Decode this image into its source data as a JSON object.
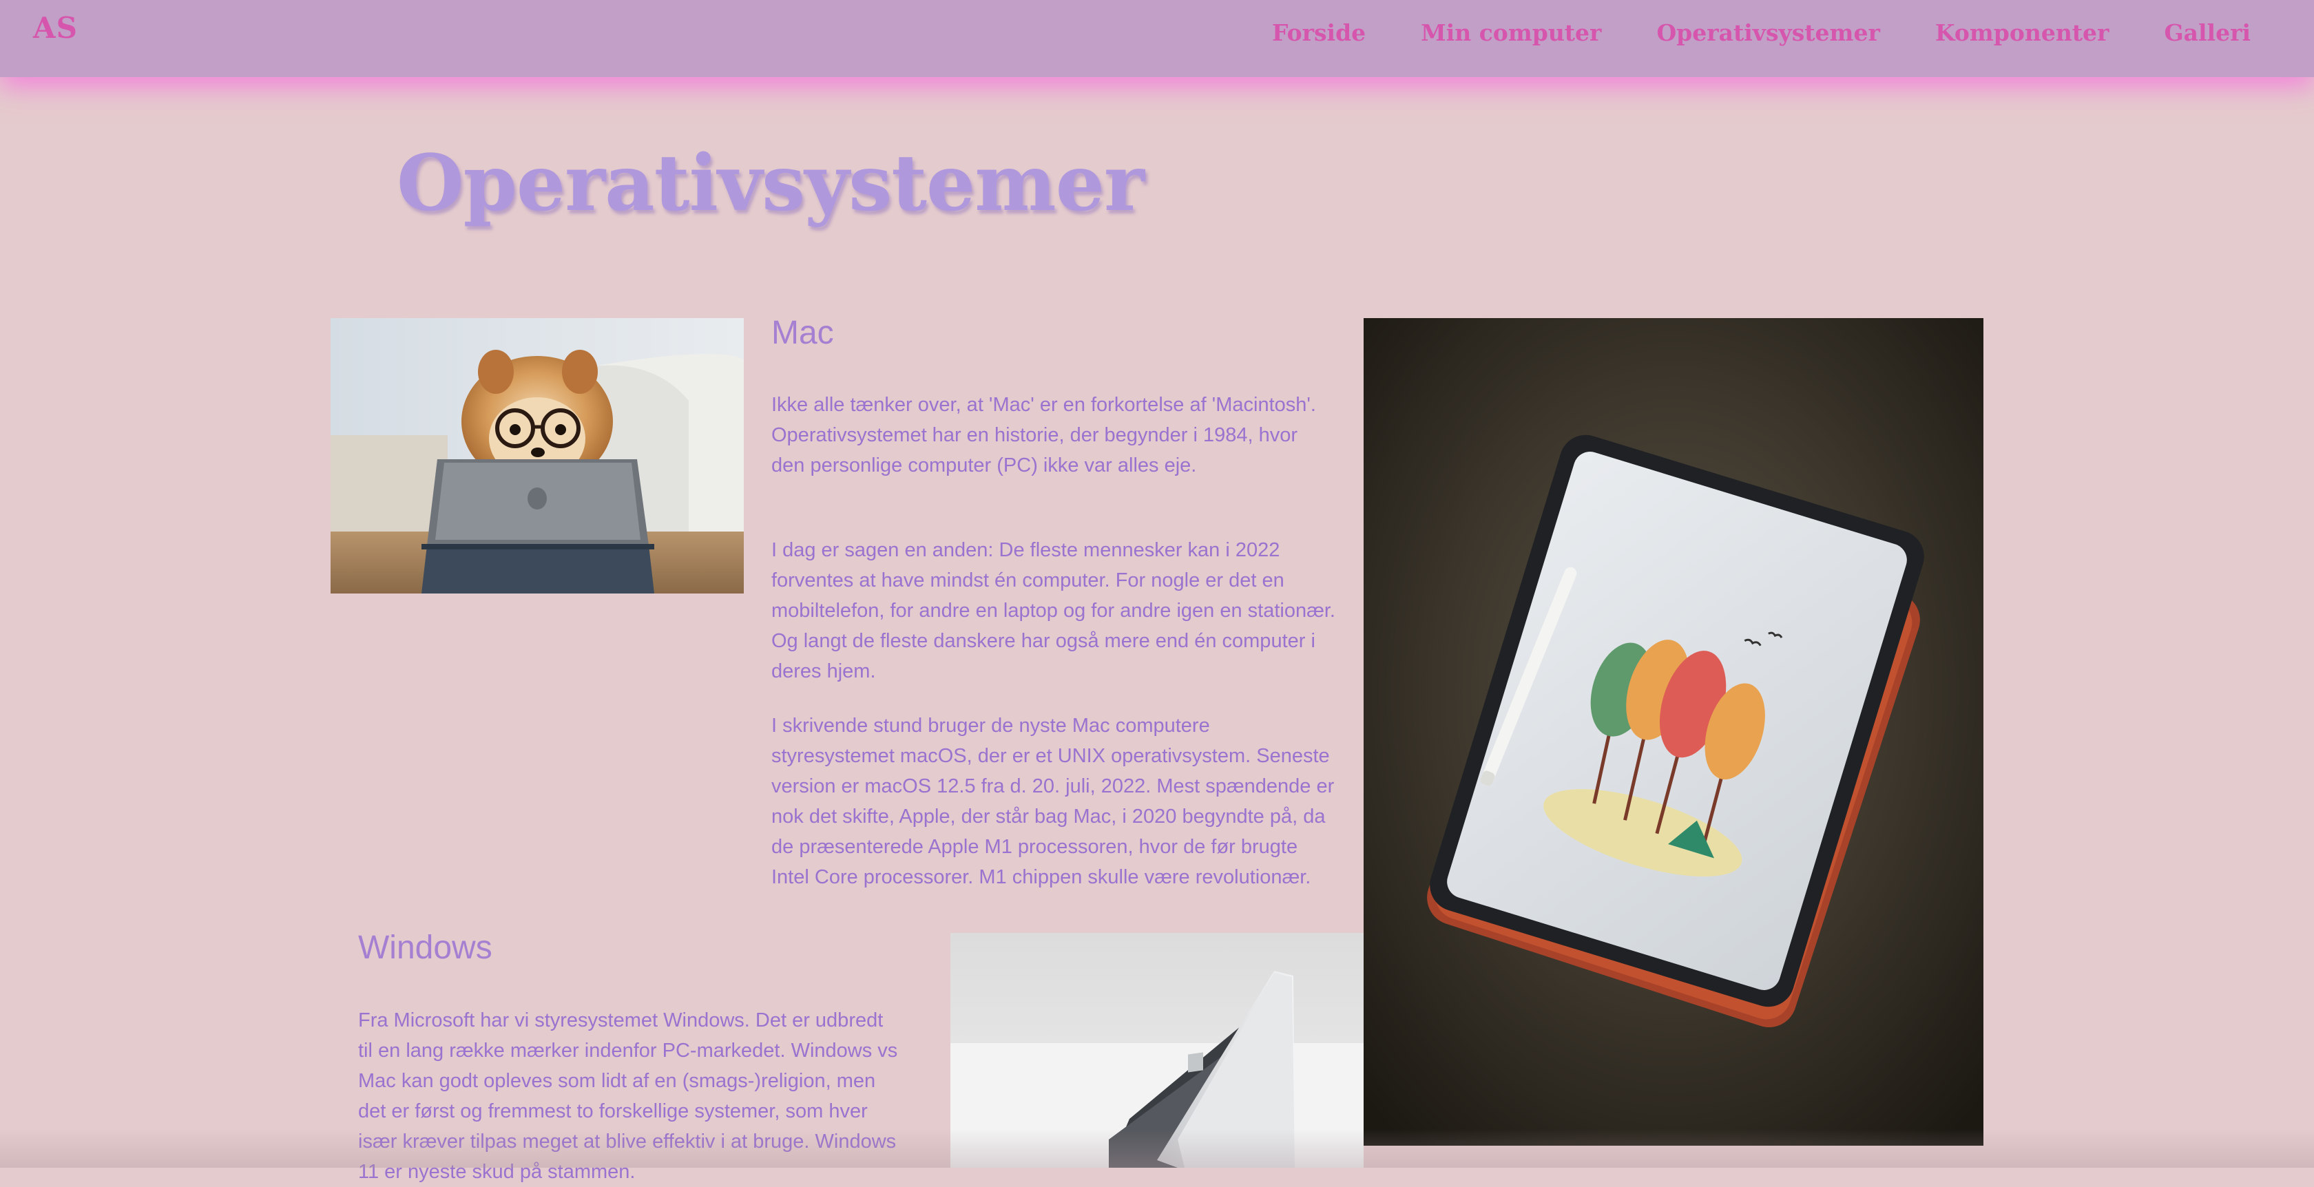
{
  "nav": {
    "logo": "AS",
    "links": [
      "Forside",
      "Min computer",
      "Operativsystemer",
      "Komponenter",
      "Galleri"
    ]
  },
  "page": {
    "title": "Operativsystemer"
  },
  "mac": {
    "heading": "Mac",
    "paragraphs": [
      "Ikke alle tænker over, at 'Mac' er en forkortelse af 'Macintosh'. Operativsystemet har en historie, der begynder i 1984, hvor den personlige computer (PC) ikke var alles eje.",
      "I dag er sagen en anden: De fleste mennesker kan i 2022 forventes at have mindst én computer. For nogle er det en mobiltelefon, for andre en laptop og for andre igen en stationær. Og langt de fleste danskere har også mere end én computer i deres hjem.",
      "I skrivende stund bruger de nyste Mac computere styresystemet macOS, der er et UNIX operativsystem. Seneste version er macOS 12.5 fra d. 20. juli, 2022. Mest spændende er nok det skifte, Apple, der står bag Mac, i 2020 begyndte på, da de præsenterede Apple M1 processoren, hvor de før brugte Intel Core processorer. M1 chippen skulle være revolutionær."
    ]
  },
  "windows": {
    "heading": "Windows",
    "paragraphs": [
      "Fra Microsoft har vi styresystemet Windows. Det er udbredt til en lang række mærker indenfor PC-markedet. Windows vs Mac kan godt opleves som lidt af en (smags-)religion, men det er først og fremmest to forskellige systemer, som hver især kræver tilpas meget at blive effektiv i at bruge. Windows 11 er nyeste skud på stammen."
    ]
  },
  "colors": {
    "background": "#e4cbcd",
    "navbar": "#c29fc7",
    "nav_text": "#d656ad",
    "title": "#b098dd",
    "heading": "#a57fd1",
    "body_text": "#9a72cf"
  },
  "images": {
    "dog": "dog-with-glasses-using-tablet-photo",
    "ipad": "ipad-with-pencil-on-orange-case-photo",
    "laptop": "silver-laptop-on-white-table-photo"
  }
}
